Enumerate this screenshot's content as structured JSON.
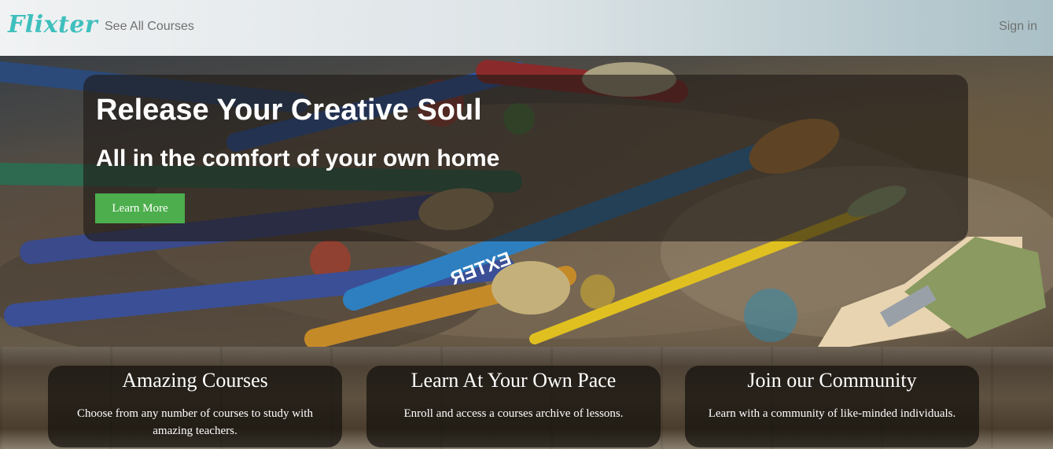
{
  "navbar": {
    "brand": "Flixter",
    "courses_link": "See All Courses",
    "signin_link": "Sign in"
  },
  "hero": {
    "title": "Release Your Creative Soul",
    "subtitle": "All in the comfort of your own home",
    "button_label": "Learn More",
    "brush_label": "EXTER"
  },
  "features": [
    {
      "title": "Amazing Courses",
      "text": "Choose from any number of courses to study with amazing teachers."
    },
    {
      "title": "Learn At Your Own Pace",
      "text": "Enroll and access a courses archive of lessons."
    },
    {
      "title": "Join our Community",
      "text": "Learn with a community of like-minded individuals."
    }
  ],
  "colors": {
    "brand": "#3fbfbd",
    "button": "#4cae4c"
  }
}
